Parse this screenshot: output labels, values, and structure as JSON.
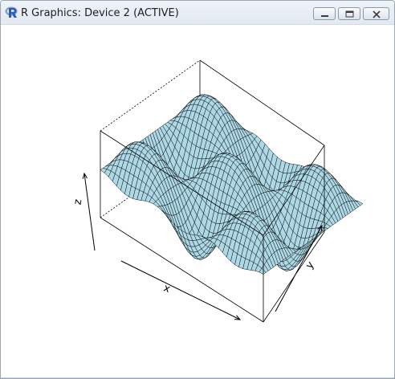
{
  "window": {
    "title": "R Graphics: Device 2 (ACTIVE)",
    "app_icon": "r-logo-icon",
    "controls": [
      "minimize-icon",
      "maximize-icon",
      "close-icon"
    ]
  },
  "plot": {
    "x_label": "x",
    "y_label": "y",
    "z_label": "z",
    "surface_color": "#add8e6",
    "line_color": "#000000"
  },
  "chart_data": {
    "type": "surface",
    "title": "",
    "xlabel": "x",
    "ylabel": "y",
    "zlabel": "z",
    "xlim": [
      0,
      1
    ],
    "ylim": [
      0,
      1
    ],
    "zlim": [
      -1,
      1
    ],
    "ticks_shown": false,
    "box": true,
    "grid": false
  }
}
